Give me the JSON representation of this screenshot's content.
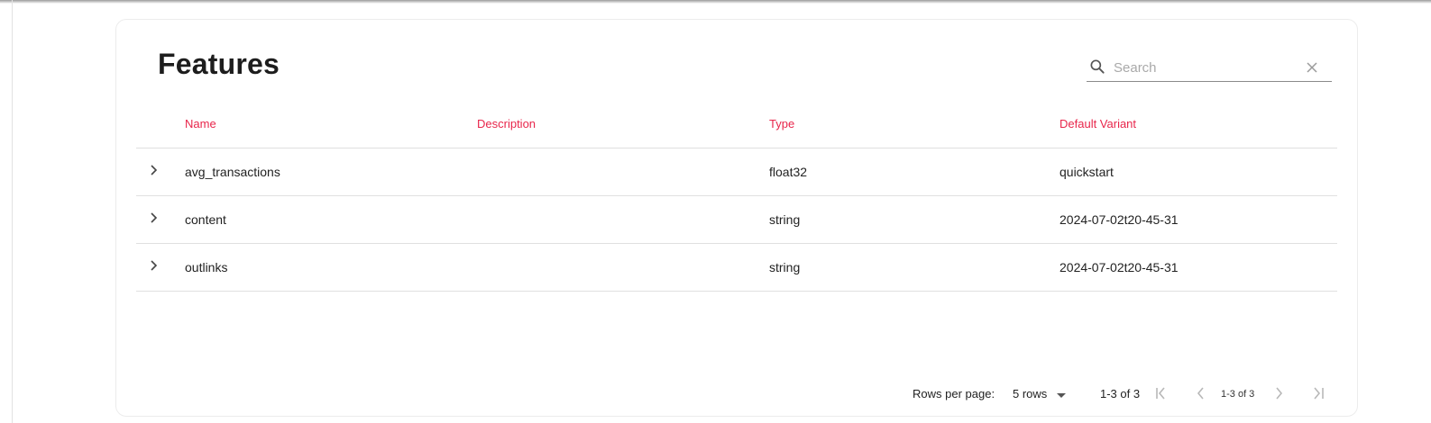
{
  "page": {
    "title": "Features"
  },
  "search": {
    "placeholder": "Search",
    "value": "",
    "icon": "search-icon",
    "clear_icon": "close-icon"
  },
  "table": {
    "columns": [
      "Name",
      "Description",
      "Type",
      "Default Variant"
    ],
    "header_color": "#e8264b",
    "rows": [
      {
        "name": "avg_transactions",
        "description": "",
        "type": "float32",
        "variant": "quickstart"
      },
      {
        "name": "content",
        "description": "",
        "type": "string",
        "variant": "2024-07-02t20-45-31"
      },
      {
        "name": "outlinks",
        "description": "",
        "type": "string",
        "variant": "2024-07-02t20-45-31"
      }
    ]
  },
  "pagination": {
    "rows_per_page_label": "Rows per page:",
    "rows_per_page_value": "5 rows",
    "range_label": "1-3 of 3",
    "page_indicator": "1-3 of 3"
  }
}
